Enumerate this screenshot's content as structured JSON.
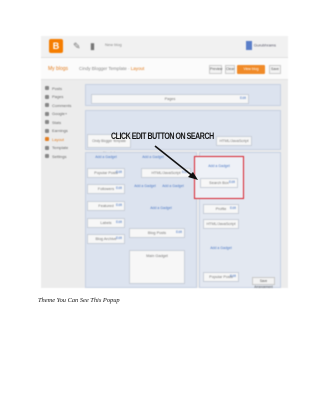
{
  "screenshot": {
    "topbar": {
      "logo_letter": "B",
      "pencil_glyph": "✎",
      "page_glyph": "▮",
      "blog_label": "New blog",
      "account_label": "Gurubhrams"
    },
    "secondbar": {
      "my_blogs": "My blogs",
      "blog_name": "Cindy Blogger Template",
      "separator": "·",
      "current_section": "Layout",
      "view_blog": "View blog",
      "preview": "Preview",
      "clear": "Clear",
      "save": "Save"
    },
    "nav_items": [
      {
        "label": "Posts",
        "active": false
      },
      {
        "label": "Pages",
        "active": false
      },
      {
        "label": "Comments",
        "active": false
      },
      {
        "label": "Google+",
        "active": false
      },
      {
        "label": "Stats",
        "active": false
      },
      {
        "label": "Earnings",
        "active": false
      },
      {
        "label": "Layout",
        "active": true
      },
      {
        "label": "Template",
        "active": false
      },
      {
        "label": "Settings",
        "active": false
      }
    ],
    "gadgets": {
      "pages": "Pages",
      "header": "Cindy Blogger Template (Header)",
      "html_right": "HTML/JavaScript",
      "add_gadget": "Add a Gadget",
      "search_box": "Search Box",
      "edit": "Edit",
      "popular_posts": "Popular Posts",
      "followers": "Followers",
      "profile": "Profile",
      "html_mid": "HTML/JavaScript",
      "featured": "Featured",
      "label": "Labels",
      "blog_archive": "Blog Archive",
      "blog_posts": "Blog Posts",
      "main_gadget": "Main Gadget",
      "popular_bottom": "Popular Posts",
      "save_arrangement": "Save Arrangement"
    },
    "callout": "CLICK EDIT BUTTON ON SEARCH"
  },
  "caption": "Theme You Can See This Popup",
  "colors": {
    "accent_orange": "#f08a28",
    "highlight_red": "#d81f2a",
    "panel_blue": "#dce3ef",
    "link_blue": "#4a77c4"
  }
}
